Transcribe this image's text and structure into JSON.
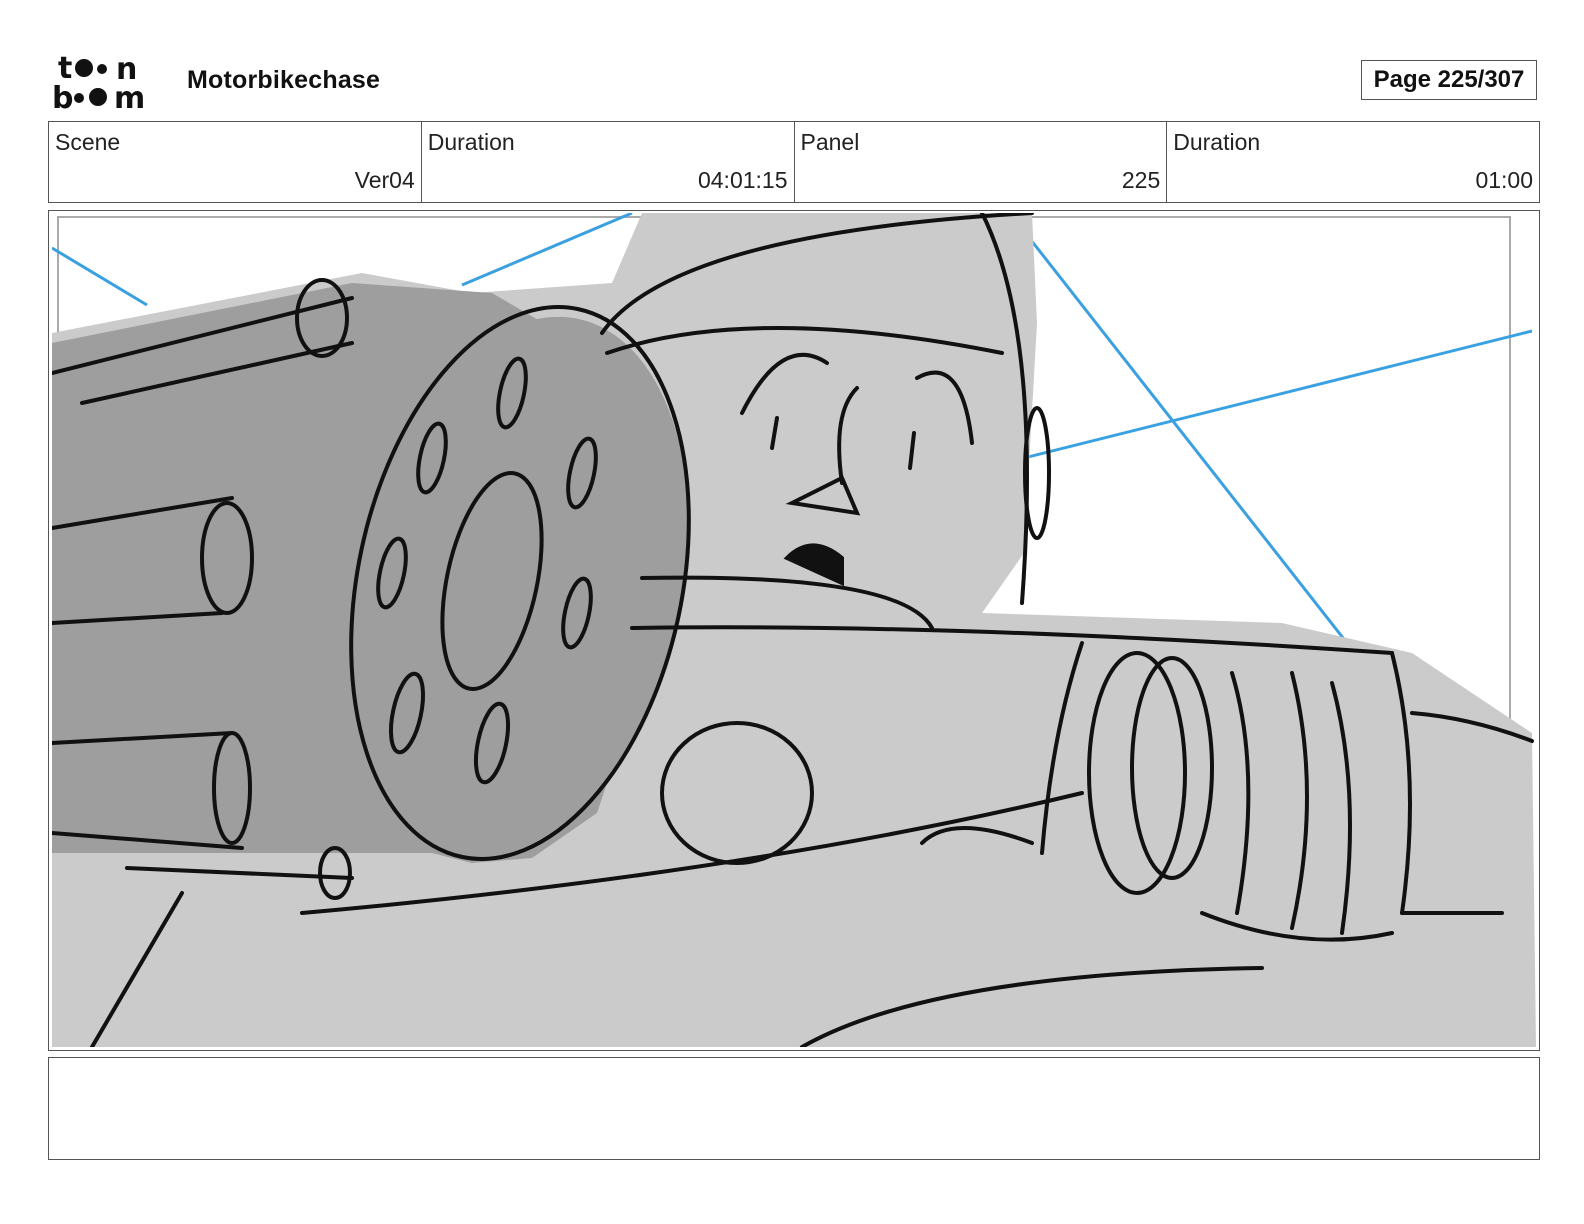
{
  "header": {
    "logo_text": "toonboom",
    "project_title": "Motorbikechase",
    "page_counter": "Page 225/307"
  },
  "info": [
    {
      "label": "Scene",
      "value": "Ver04"
    },
    {
      "label": "Duration",
      "value": "04:01:15"
    },
    {
      "label": "Panel",
      "value": "225"
    },
    {
      "label": "Duration",
      "value": "01:00"
    }
  ],
  "panel": {
    "colors": {
      "fill_light": "#cbcbcb",
      "fill_dark": "#9e9e9e",
      "ink": "#111111",
      "guide_lines": "#3aa0e0"
    }
  },
  "notes": {
    "text": ""
  }
}
